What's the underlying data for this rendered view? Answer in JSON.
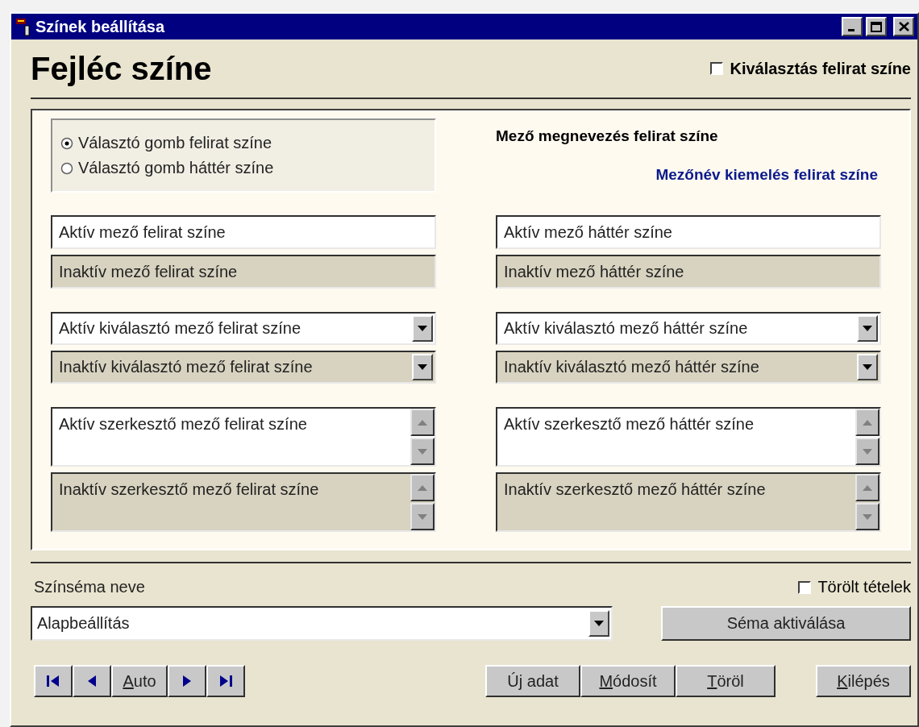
{
  "window": {
    "title": "Színek beállítása"
  },
  "heading": "Fejléc színe",
  "selection_caption": {
    "label": "Kiválasztás felirat színe",
    "checked": false
  },
  "radio_options": [
    {
      "label": "Választó gomb felirat színe",
      "selected": true
    },
    {
      "label": "Választó gomb háttér színe",
      "selected": false
    }
  ],
  "field_caption": "Mező megnevezés felirat színe",
  "highlight_caption": "Mezőnév kiemelés felirat színe",
  "columns": [
    {
      "fields": [
        {
          "kind": "text",
          "value": "Aktív mező felirat színe",
          "active": true
        },
        {
          "kind": "text",
          "value": "Inaktív mező felirat színe",
          "active": false
        },
        {
          "kind": "combo",
          "value": "Aktív kiválasztó mező felirat színe",
          "active": true
        },
        {
          "kind": "combo",
          "value": "Inaktív kiválasztó mező felirat színe",
          "active": false
        },
        {
          "kind": "memo",
          "value": "Aktív szerkesztő mező felirat színe",
          "active": true
        },
        {
          "kind": "memo",
          "value": "Inaktív szerkesztő mező felirat színe",
          "active": false
        }
      ]
    },
    {
      "fields": [
        {
          "kind": "text",
          "value": "Aktív mező háttér színe",
          "active": true
        },
        {
          "kind": "text",
          "value": "Inaktív mező háttér színe",
          "active": false
        },
        {
          "kind": "combo",
          "value": "Aktív kiválasztó mező háttér színe",
          "active": true
        },
        {
          "kind": "combo",
          "value": "Inaktív kiválasztó mező háttér színe",
          "active": false
        },
        {
          "kind": "memo",
          "value": "Aktív szerkesztő mező háttér színe",
          "active": true
        },
        {
          "kind": "memo",
          "value": "Inaktív szerkesztő mező háttér színe",
          "active": false
        }
      ]
    }
  ],
  "scheme": {
    "label": "Színséma neve",
    "value": "Alapbeállítás"
  },
  "deleted_items": {
    "label": "Törölt tételek",
    "checked": false
  },
  "activate_button": "Séma aktiválása",
  "nav_buttons": [
    {
      "kind": "first"
    },
    {
      "kind": "prev"
    },
    {
      "kind": "text",
      "key": "A",
      "after": "uto"
    },
    {
      "kind": "next"
    },
    {
      "kind": "last"
    }
  ],
  "action_buttons": [
    {
      "before": "Ú",
      "key": "j",
      "after": " adat"
    },
    {
      "key": "M",
      "after": "ódosít"
    },
    {
      "key": "T",
      "after": "öröl"
    }
  ],
  "exit_button": {
    "key": "K",
    "after": "ilépés"
  }
}
